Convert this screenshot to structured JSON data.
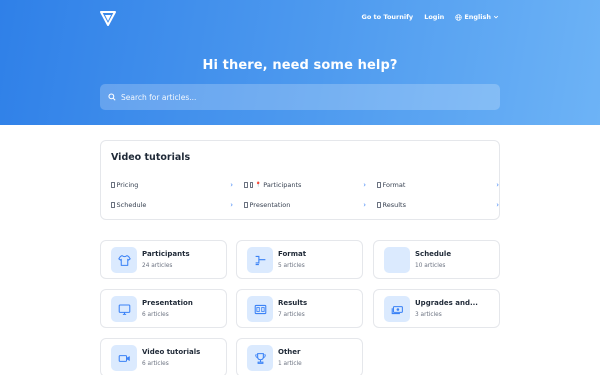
{
  "colors": {
    "hero_start": "#2f80e8",
    "hero_end": "#6db3f6",
    "accent": "#3b82f6",
    "icon_bg": "#dbeafe"
  },
  "nav": {
    "logo_icon": "tournify-logo-icon",
    "go_to_tournify": "Go to Tournify",
    "login": "Login",
    "language": "English",
    "language_icon": "globe-icon"
  },
  "hero": {
    "title": "Hi there, need some help?"
  },
  "search": {
    "placeholder": "Search for articles...",
    "icon": "search-icon"
  },
  "video_tutorials": {
    "title": "Video tutorials",
    "links": [
      {
        "label": "Pricing"
      },
      {
        "label": "Participants",
        "prefix": "📍"
      },
      {
        "label": "Format"
      },
      {
        "label": "Schedule"
      },
      {
        "label": "Presentation"
      },
      {
        "label": "Results"
      }
    ]
  },
  "categories": [
    {
      "title": "Participants",
      "count": "24 articles",
      "icon": "shirt-icon"
    },
    {
      "title": "Format",
      "count": "5 articles",
      "icon": "bracket-icon"
    },
    {
      "title": "Schedule",
      "count": "10 articles",
      "icon": ""
    },
    {
      "title": "Presentation",
      "count": "6 articles",
      "icon": "monitor-icon"
    },
    {
      "title": "Results",
      "count": "7 articles",
      "icon": "scoreboard-icon"
    },
    {
      "title": "Upgrades and...",
      "count": "3 articles",
      "icon": "money-icon"
    },
    {
      "title": "Video tutorials",
      "count": "6 articles",
      "icon": "video-icon"
    },
    {
      "title": "Other",
      "count": "1 article",
      "icon": "trophy-icon"
    }
  ]
}
